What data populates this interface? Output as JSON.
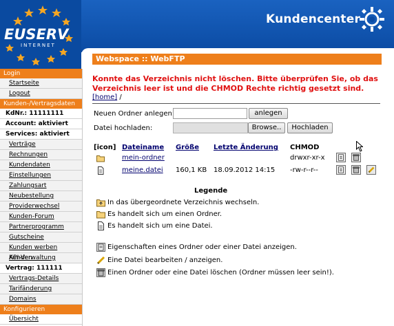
{
  "brand": {
    "logo_text": "EUSERV",
    "logo_sub": "INTERNET",
    "title": "Kundencenter"
  },
  "sidebar": {
    "login_header": "Login",
    "login_links": [
      "Startseite",
      "Logout"
    ],
    "account_header": "Kunden-/Vertragsdaten",
    "kdnr": "KdNr.: 11111111",
    "account_status": "Account: aktiviert",
    "services_status": "Services: aktiviert",
    "links": [
      "Verträge",
      "Rechnungen",
      "Kundendaten",
      "Einstellungen",
      "Zahlungsart",
      "Neubestellung",
      "Providerwechsel",
      "Kunden-Forum",
      "Partnerprogramm",
      "Gutscheine",
      "Kunden werben Kunden",
      "API-Verwaltung"
    ],
    "contract": "Vertrag: 111111",
    "contract_links": [
      "Vertrags-Details",
      "Tarifänderung",
      "Domains"
    ],
    "config_header": "Konfigurieren",
    "config_links": [
      "Übersicht"
    ]
  },
  "main": {
    "title": "Webspace :: WebFTP",
    "error": "Konnte das Verzeichnis nicht löschen. Bitte überprüfen Sie, ob das Verzeichnis leer ist und die CHMOD Rechte richtig gesetzt sind.",
    "breadcrumb_link": "[home]",
    "breadcrumb_sep": " /",
    "new_folder_label": "Neuen Ordner anlegen:",
    "new_folder_value": "",
    "create_button": "anlegen",
    "upload_label": "Datei hochladen:",
    "browse_button": "Browse..",
    "upload_button": "Hochladen"
  },
  "table": {
    "headers": {
      "icon": "[icon]",
      "name": "Dateiname",
      "size": "Größe",
      "changed": "Letzte Änderung",
      "chmod": "CHMOD"
    },
    "rows": [
      {
        "type": "folder",
        "name": "mein-ordner",
        "size": "",
        "changed": "",
        "chmod": "drwxr-xr-x"
      },
      {
        "type": "file",
        "name": "meine.datei",
        "size": "160,1 KB",
        "changed": "18.09.2012 14:15",
        "chmod": "-rw-r--r--"
      }
    ]
  },
  "legend": {
    "title": "Legende",
    "items": [
      "In das übergeordnete Verzeichnis wechseln.",
      "Es handelt sich um einen Ordner.",
      "Es handelt sich um eine Datei.",
      "Eigenschaften eines Ordner oder einer Datei anzeigen.",
      "Eine Datei bearbeiten / anzeigen.",
      "Einen Ordner oder eine Datei löschen (Ordner müssen leer sein!)."
    ]
  },
  "colors": {
    "header_blue": "#0a4aa0",
    "orange": "#ee7f1b",
    "error_red": "#e01010",
    "link_blue": "#00006e"
  }
}
